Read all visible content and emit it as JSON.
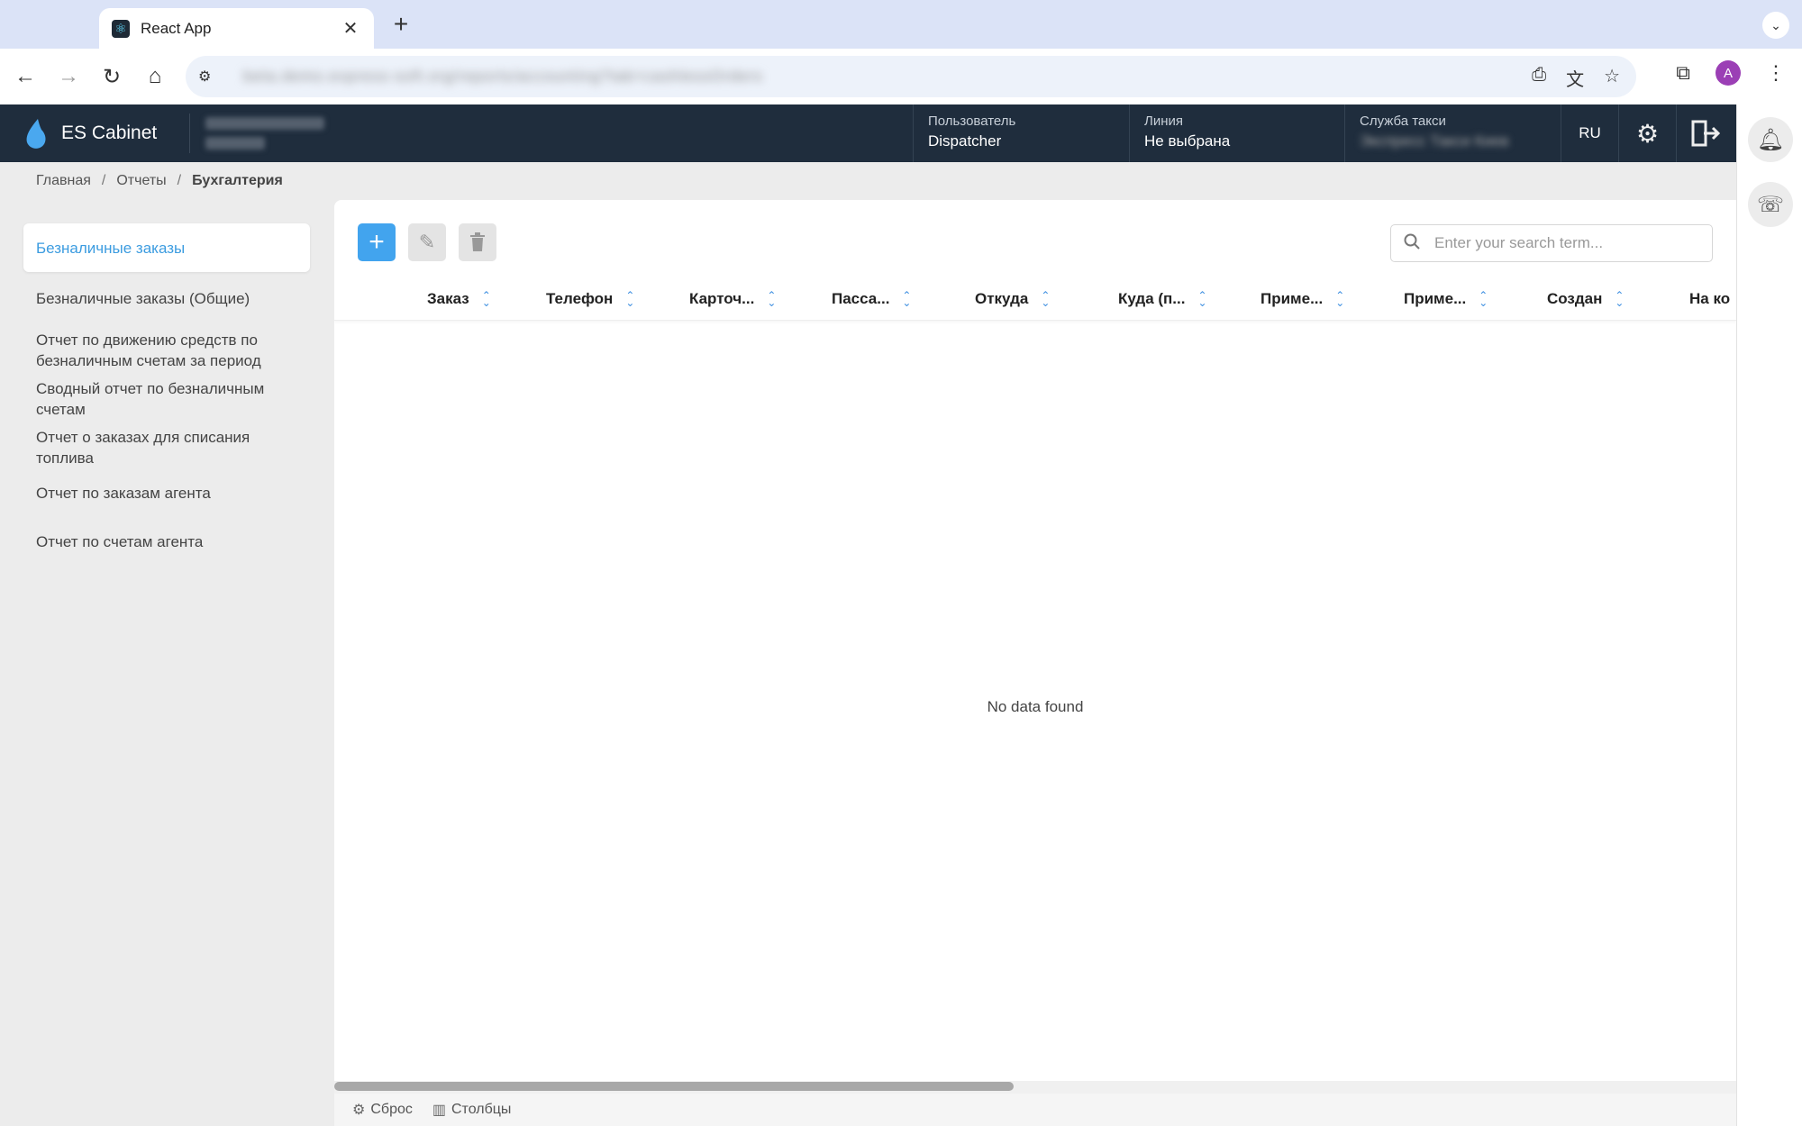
{
  "browser": {
    "tab_title": "React App",
    "tab_close": "✕",
    "new_tab": "+",
    "url": "beta.demo.express-soft.org/reports/accounting?tab=cashlessOrders",
    "avatar_letter": "A"
  },
  "header": {
    "app_title": "ES Cabinet",
    "user_label": "Пользователь",
    "user_value": "Dispatcher",
    "line_label": "Линия",
    "line_value": "Не выбрана",
    "taxi_label": "Служба такси",
    "taxi_value": "Экспресс Такси Киев",
    "lang": "RU"
  },
  "breadcrumb": {
    "home": "Главная",
    "reports": "Отчеты",
    "current": "Бухгалтерия",
    "sep": "/"
  },
  "sidebar": {
    "items": [
      {
        "label": "Безналичные заказы"
      },
      {
        "label": "Безналичные заказы (Общие)"
      },
      {
        "label": "Отчет по движению средств по безналичным счетам за период"
      },
      {
        "label": "Сводный отчет по безналичным счетам"
      },
      {
        "label": "Отчет о заказах для списания топлива"
      },
      {
        "label": "Отчет по заказам агента"
      },
      {
        "label": "Отчет по счетам агента"
      }
    ]
  },
  "toolbar": {
    "add": "+",
    "search_placeholder": "Enter your search term..."
  },
  "table": {
    "columns": [
      {
        "label": "Заказ"
      },
      {
        "label": "Телефон"
      },
      {
        "label": "Карточ..."
      },
      {
        "label": "Пасса..."
      },
      {
        "label": "Откуда"
      },
      {
        "label": "Куда (п..."
      },
      {
        "label": "Приме..."
      },
      {
        "label": "Приме..."
      },
      {
        "label": "Создан"
      },
      {
        "label": "На ко"
      }
    ],
    "empty_message": "No data found"
  },
  "footer": {
    "reset": "Сброс",
    "columns": "Столбцы"
  },
  "colors": {
    "accent": "#42a4ee",
    "header_bg": "#1f2d3d",
    "avatar": "#9b3fb5"
  }
}
